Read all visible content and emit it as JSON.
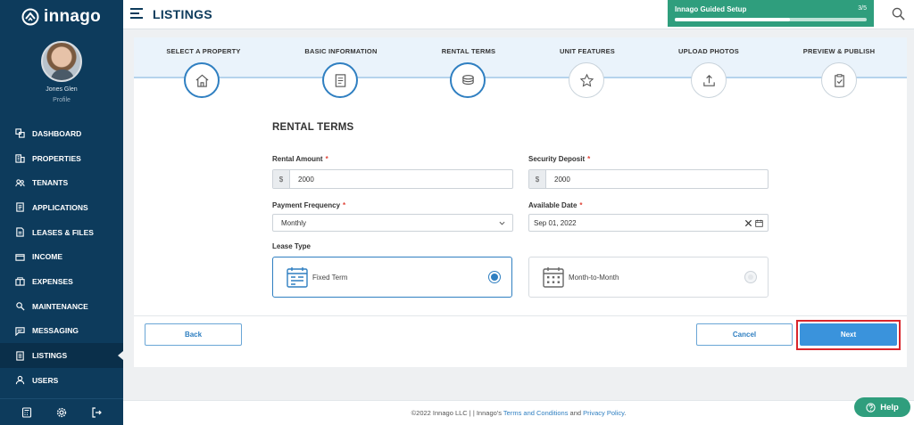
{
  "app": {
    "logo_text": "innago"
  },
  "user": {
    "name": "Jones Glen",
    "profile_label": "Profile"
  },
  "sidebar": {
    "items": [
      {
        "label": "DASHBOARD",
        "icon": "dashboard-icon"
      },
      {
        "label": "PROPERTIES",
        "icon": "building-icon"
      },
      {
        "label": "TENANTS",
        "icon": "people-icon"
      },
      {
        "label": "APPLICATIONS",
        "icon": "document-icon"
      },
      {
        "label": "LEASES & FILES",
        "icon": "file-icon"
      },
      {
        "label": "INCOME",
        "icon": "wallet-icon"
      },
      {
        "label": "EXPENSES",
        "icon": "box-icon"
      },
      {
        "label": "MAINTENANCE",
        "icon": "wrench-icon"
      },
      {
        "label": "MESSAGING",
        "icon": "chat-icon"
      },
      {
        "label": "LISTINGS",
        "icon": "listing-icon",
        "active": true
      },
      {
        "label": "USERS",
        "icon": "user-icon"
      }
    ],
    "bottom_icons": [
      "calculator-icon",
      "settings-icon",
      "logout-icon"
    ]
  },
  "header": {
    "title": "LISTINGS",
    "guided_setup": {
      "label": "Innago Guided Setup",
      "count": "3/5",
      "progress": 0.6,
      "color": "#2f9e7d"
    }
  },
  "steps": [
    {
      "label": "SELECT A PROPERTY",
      "icon": "home-icon",
      "state": "done"
    },
    {
      "label": "BASIC INFORMATION",
      "icon": "info-document-icon",
      "state": "done"
    },
    {
      "label": "RENTAL TERMS",
      "icon": "coins-icon",
      "state": "current"
    },
    {
      "label": "UNIT FEATURES",
      "icon": "star-icon",
      "state": "todo"
    },
    {
      "label": "UPLOAD PHOTOS",
      "icon": "upload-icon",
      "state": "todo"
    },
    {
      "label": "PREVIEW & PUBLISH",
      "icon": "clipboard-check-icon",
      "state": "todo"
    }
  ],
  "form": {
    "section_title": "RENTAL TERMS",
    "rental_amount": {
      "label": "Rental Amount",
      "required_mark": "*",
      "prefix": "$",
      "value": "2000"
    },
    "security_deposit": {
      "label": "Security Deposit",
      "required_mark": "*",
      "prefix": "$",
      "value": "2000"
    },
    "payment_frequency": {
      "label": "Payment Frequency",
      "required_mark": "*",
      "value": "Monthly"
    },
    "available_date": {
      "label": "Available Date",
      "required_mark": "*",
      "value": "Sep 01, 2022"
    },
    "lease_type": {
      "label": "Lease Type",
      "options": [
        {
          "label": "Fixed Term",
          "selected": true
        },
        {
          "label": "Month-to-Month",
          "selected": false
        }
      ]
    }
  },
  "actions": {
    "back": "Back",
    "cancel": "Cancel",
    "next": "Next"
  },
  "footer": {
    "prefix": "©2022 Innago LLC | | Innago's ",
    "terms": "Terms and Conditions",
    "and": " and ",
    "privacy": "Privacy Policy",
    "suffix": "."
  },
  "help": {
    "label": "Help"
  },
  "colors": {
    "sidebar": "#0d3b5c",
    "accent": "#2f7fc1",
    "primary_button": "#3a93dc",
    "green": "#2f9e7d",
    "highlight": "#d9262c"
  }
}
